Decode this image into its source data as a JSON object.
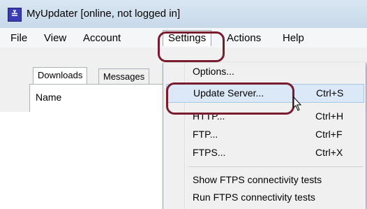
{
  "window": {
    "title": "MyUpdater [online, not logged in]",
    "app_icon_glyph": "≚"
  },
  "menubar": {
    "items": [
      "File",
      "View",
      "Account",
      "Settings",
      "Actions",
      "Help"
    ],
    "open_menu": "Settings"
  },
  "tabs": {
    "items": [
      "Downloads",
      "Messages"
    ],
    "active": "Downloads"
  },
  "list": {
    "column_header": "Name"
  },
  "settings_menu": {
    "items": [
      {
        "label": "Options...",
        "shortcut": ""
      },
      {
        "label": "Update Server...",
        "shortcut": "Ctrl+S"
      },
      {
        "label": "HTTP...",
        "shortcut": "Ctrl+H"
      },
      {
        "label": "FTP...",
        "shortcut": "Ctrl+F"
      },
      {
        "label": "FTPS...",
        "shortcut": "Ctrl+X"
      },
      {
        "label": "Show FTPS connectivity tests",
        "shortcut": ""
      },
      {
        "label": "Run FTPS connectivity tests",
        "shortcut": ""
      }
    ],
    "highlighted": "Update Server..."
  },
  "colors": {
    "annotation": "#7a1c30",
    "highlight": "#dbe8f7"
  }
}
